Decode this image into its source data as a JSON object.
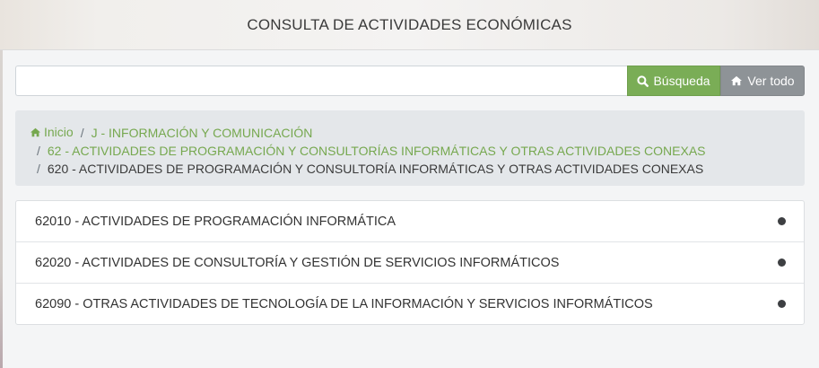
{
  "header": {
    "title": "CONSULTA DE ACTIVIDADES ECONÓMICAS"
  },
  "search": {
    "value": "",
    "placeholder": "",
    "search_button_label": "Búsqueda",
    "view_all_button_label": "Ver todo",
    "search_icon": "search-icon",
    "home_icon": "home-icon"
  },
  "breadcrumb": {
    "home_label": "Inicio",
    "items": [
      {
        "label": "J - INFORMACIÓN Y COMUNICACIÓN",
        "link": true
      },
      {
        "label": "62 - ACTIVIDADES DE PROGRAMACIÓN Y CONSULTORÍAS INFORMÁTICAS Y OTRAS ACTIVIDADES CONEXAS",
        "link": true
      },
      {
        "label": "620 - ACTIVIDADES DE PROGRAMACIÓN Y CONSULTORÍA INFORMÁTICAS Y OTRAS ACTIVIDADES CONEXAS",
        "link": false
      }
    ]
  },
  "activities": [
    {
      "label": "62010 - ACTIVIDADES DE PROGRAMACIÓN INFORMÁTICA"
    },
    {
      "label": "62020 - ACTIVIDADES DE CONSULTORÍA Y GESTIÓN DE SERVICIOS INFORMÁTICOS"
    },
    {
      "label": "62090 - OTRAS ACTIVIDADES DE TECNOLOGÍA DE LA INFORMACIÓN Y SERVICIOS INFORMÁTICOS"
    }
  ],
  "colors": {
    "accent_green": "#7aad56",
    "button_gray": "#8e9397",
    "link_green": "#76a84f"
  }
}
